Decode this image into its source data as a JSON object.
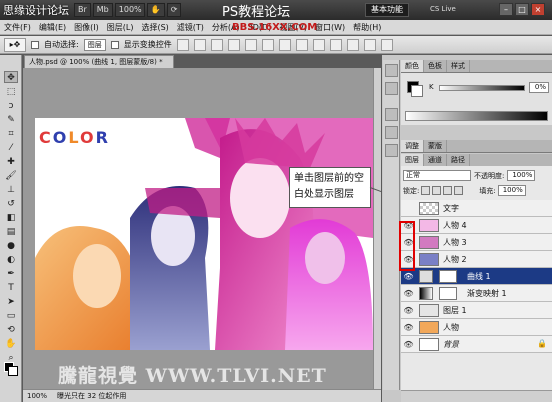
{
  "window": {
    "watermark_top": "思缘设计论坛",
    "app_bar": {
      "br": "Br",
      "mb": "Mb",
      "zoom": "100%"
    },
    "ps_logo": "PS教程论坛",
    "workspace": "基本功能",
    "cs_live": "CS Live"
  },
  "menu": {
    "items": [
      "文件(F)",
      "编辑(E)",
      "图像(I)",
      "图层(L)",
      "选择(S)",
      "滤镜(T)",
      "分析(A)",
      "3D(D)",
      "视图(V)",
      "窗口(W)",
      "帮助(H)"
    ],
    "watermark_url": "BBS.16XX.COM"
  },
  "options": {
    "auto_select_label": "自动选择:",
    "auto_select_value": "图层",
    "transform_controls_label": "显示变换控件"
  },
  "document": {
    "tab_title": "人物.psd @ 100% (曲线 1, 图层蒙版/8) *",
    "canvas_text": [
      "C",
      "O",
      "L",
      "O",
      "R"
    ],
    "canvas_colors": [
      "#e03a3a",
      "#2f3fae",
      "#f08a2a",
      "#e03a3a",
      "#2f3fae"
    ],
    "watermark_bottom": "騰龍視覺 WWW.TLVI.NET"
  },
  "status": {
    "zoom": "100%",
    "info": "曝光只在 32 位起作用"
  },
  "callout": {
    "line1": "单击图层前的空",
    "line2": "白处显示图层"
  },
  "color_panel": {
    "tabs": [
      "颜色",
      "色板",
      "样式"
    ],
    "channel": "K",
    "value": "0",
    "unit": "%"
  },
  "adjust_panel": {
    "tabs": [
      "调整",
      "蒙版"
    ]
  },
  "layers_panel": {
    "tabs": [
      "图层",
      "通道",
      "路径"
    ],
    "blend_mode": "正常",
    "opacity_label": "不透明度:",
    "opacity_value": "100%",
    "lock_label": "锁定:",
    "fill_label": "填充:",
    "fill_value": "100%",
    "layers": [
      {
        "name": "文字",
        "visible": false,
        "selected": false
      },
      {
        "name": "人物 4",
        "visible": true,
        "selected": false
      },
      {
        "name": "人物 3",
        "visible": true,
        "selected": false
      },
      {
        "name": "人物 2",
        "visible": true,
        "selected": false
      },
      {
        "name": "曲线 1",
        "visible": true,
        "selected": true
      },
      {
        "name": "渐变映射 1",
        "visible": true,
        "selected": false
      },
      {
        "name": "图层 1",
        "visible": true,
        "selected": false
      },
      {
        "name": "人物",
        "visible": true,
        "selected": false
      },
      {
        "name": "背景",
        "visible": true,
        "selected": false
      }
    ]
  }
}
